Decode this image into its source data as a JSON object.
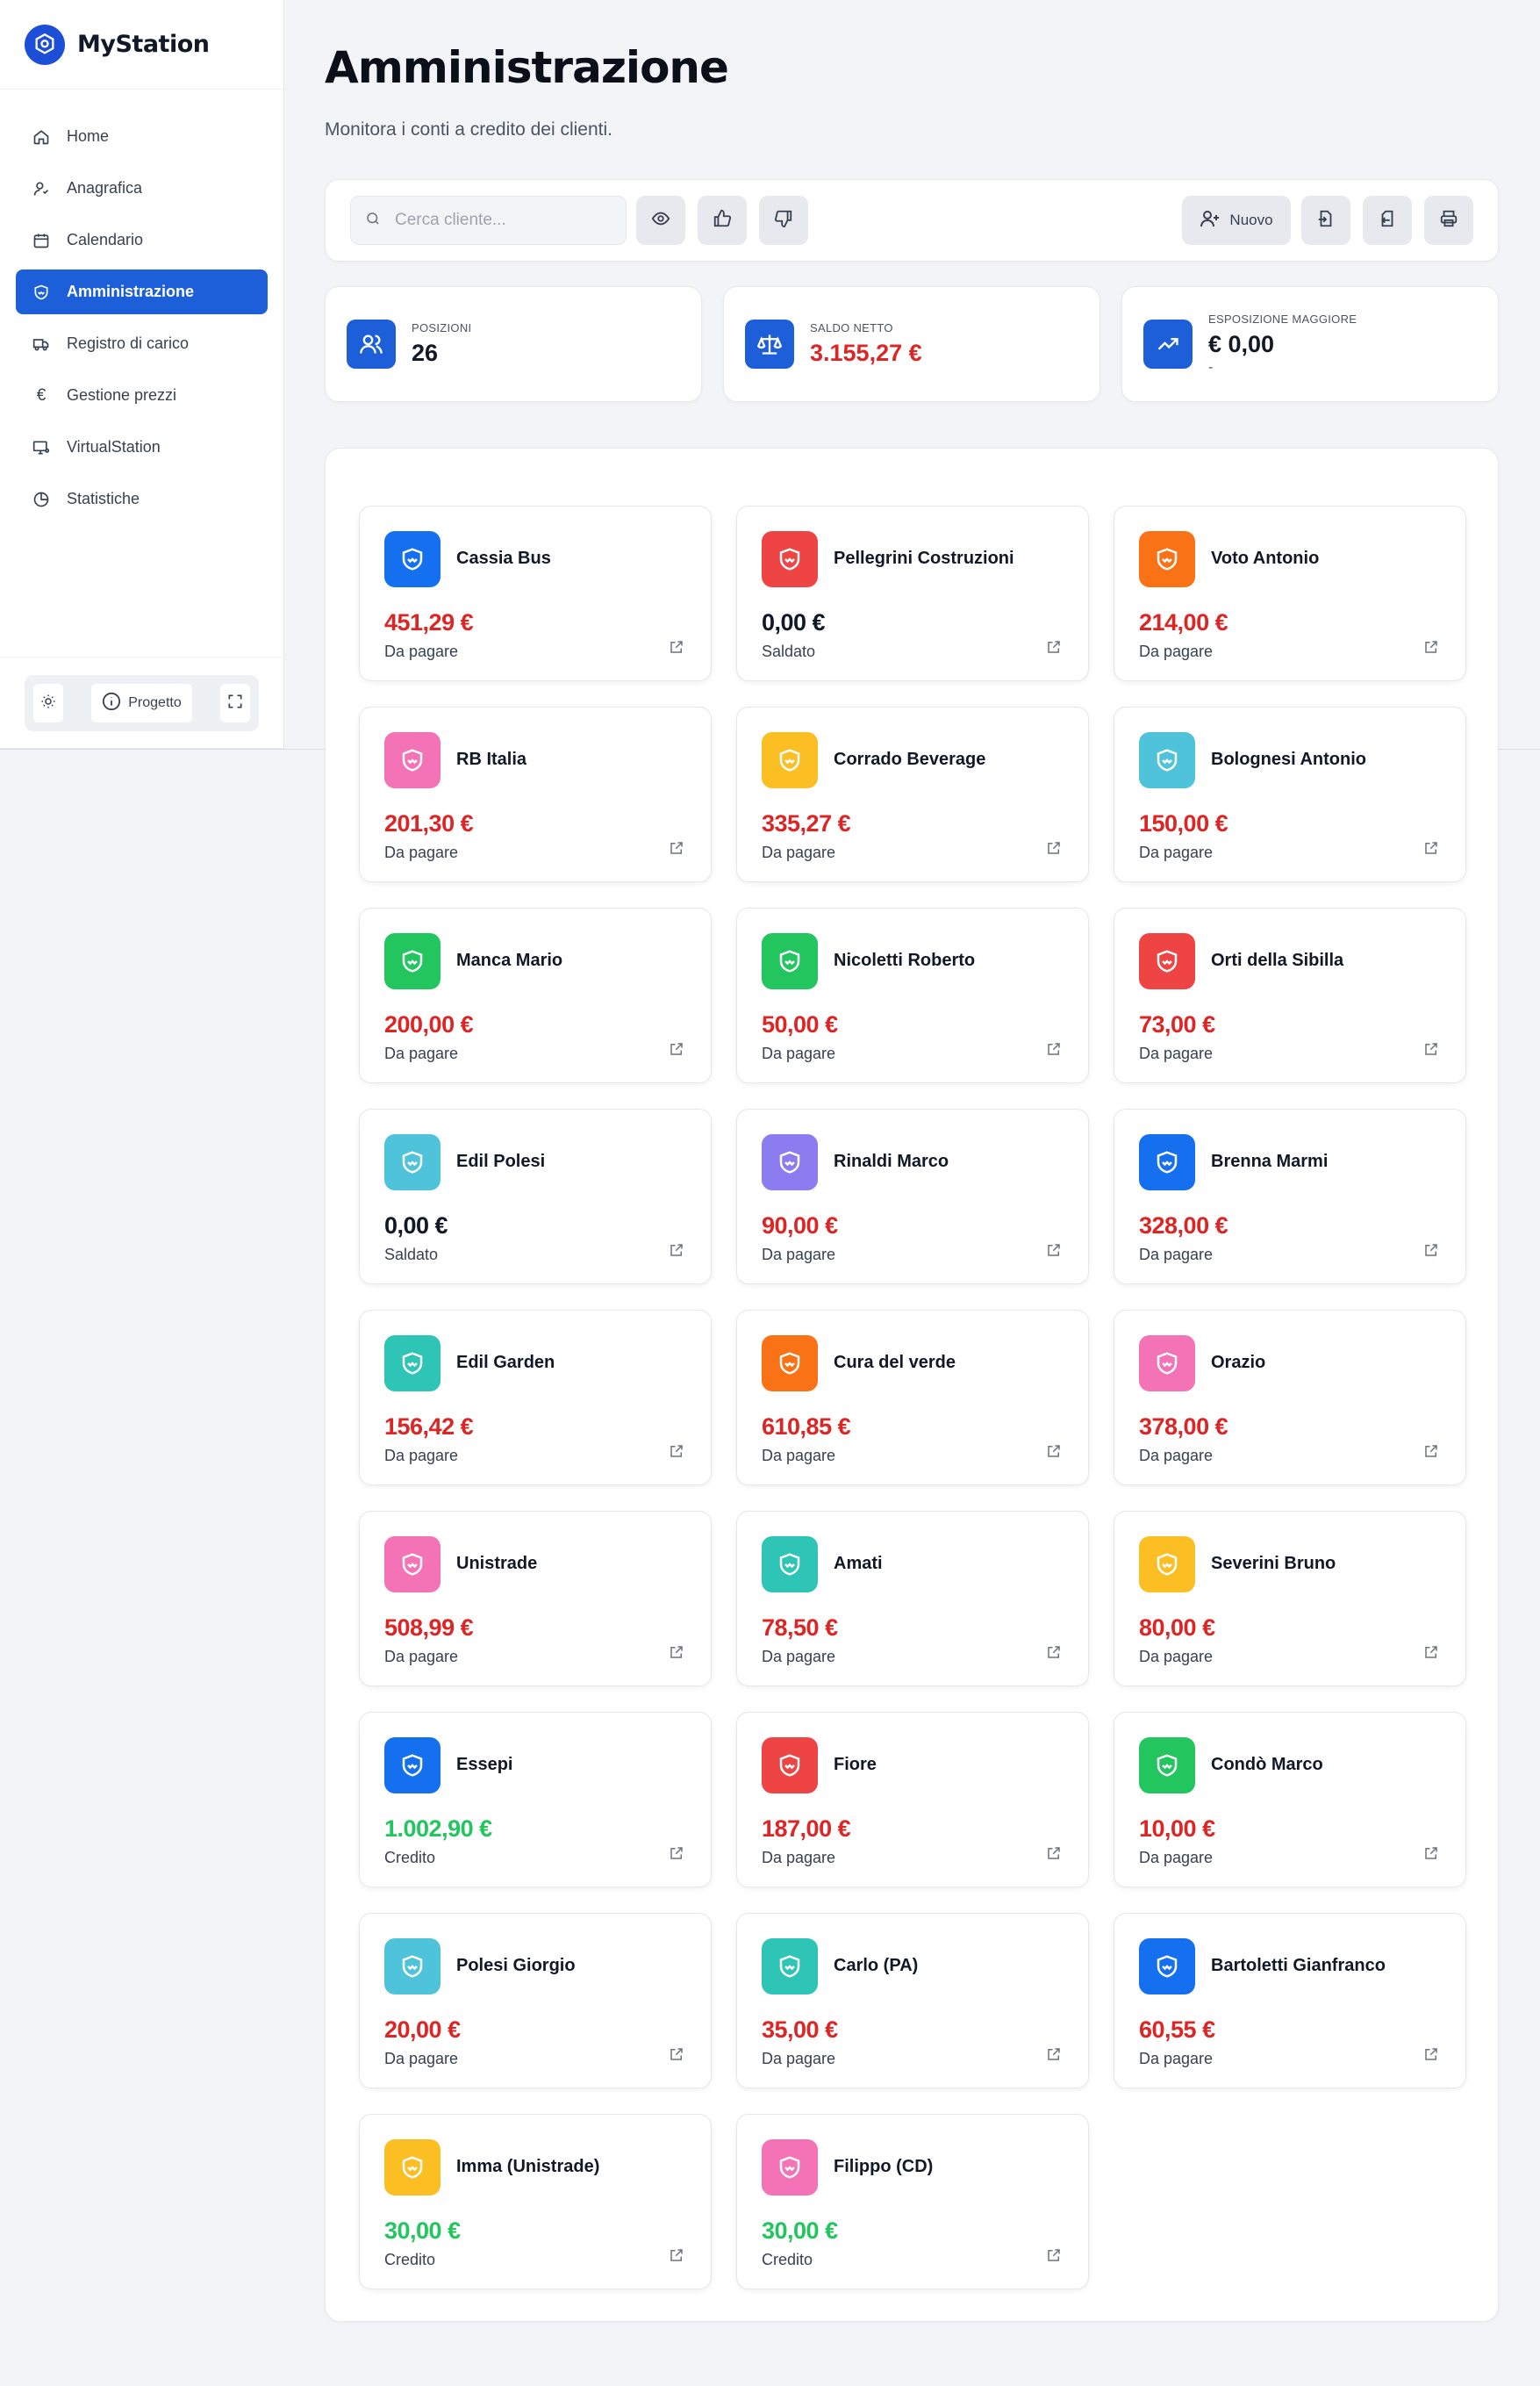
{
  "app": {
    "name": "MyStation"
  },
  "sidebar": {
    "items": [
      {
        "label": "Home",
        "icon": "home-icon",
        "active": false
      },
      {
        "label": "Anagrafica",
        "icon": "user-icon",
        "active": false
      },
      {
        "label": "Calendario",
        "icon": "calendar-icon",
        "active": false
      },
      {
        "label": "Amministrazione",
        "icon": "handshake-icon",
        "active": true
      },
      {
        "label": "Registro di carico",
        "icon": "truck-icon",
        "active": false
      },
      {
        "label": "Gestione prezzi",
        "icon": "euro-icon",
        "active": false
      },
      {
        "label": "VirtualStation",
        "icon": "monitor-icon",
        "active": false
      },
      {
        "label": "Statistiche",
        "icon": "pie-chart-icon",
        "active": false
      }
    ],
    "footer": {
      "project_label": "Progetto"
    }
  },
  "header": {
    "title": "Amministrazione",
    "subtitle": "Monitora i conti a credito dei clienti."
  },
  "toolbar": {
    "search_placeholder": "Cerca cliente...",
    "new_label": "Nuovo"
  },
  "stats": [
    {
      "label": "Posizioni",
      "value": "26",
      "sub": "",
      "color": "#111827",
      "icon": "users-icon"
    },
    {
      "label": "Saldo netto",
      "value": "3.155,27 €",
      "sub": "",
      "color": "#dc2626",
      "icon": "scale-icon"
    },
    {
      "label": "Esposizione maggiore",
      "value": "€ 0,00",
      "sub": "-",
      "color": "#111827",
      "icon": "trending-up-icon"
    }
  ],
  "colors": {
    "accent": "#1d5fd9",
    "due": "#dc2626",
    "credit": "#22c55e",
    "settled": "#111827"
  },
  "clients": [
    {
      "name": "Cassia Bus",
      "amount": "451,29 €",
      "status": "Da pagare",
      "color": "#1570ef",
      "kind": "due"
    },
    {
      "name": "Pellegrini Costruzioni",
      "amount": "0,00 €",
      "status": "Saldato",
      "color": "#ef4444",
      "kind": "settled"
    },
    {
      "name": "Voto Antonio",
      "amount": "214,00 €",
      "status": "Da pagare",
      "color": "#f97316",
      "kind": "due"
    },
    {
      "name": "RB Italia",
      "amount": "201,30 €",
      "status": "Da pagare",
      "color": "#f472b6",
      "kind": "due"
    },
    {
      "name": "Corrado Beverage",
      "amount": "335,27 €",
      "status": "Da pagare",
      "color": "#fbbf24",
      "kind": "due"
    },
    {
      "name": "Bolognesi Antonio",
      "amount": "150,00 €",
      "status": "Da pagare",
      "color": "#4fc3d9",
      "kind": "due"
    },
    {
      "name": "Manca Mario",
      "amount": "200,00 €",
      "status": "Da pagare",
      "color": "#22c55e",
      "kind": "due"
    },
    {
      "name": "Nicoletti Roberto",
      "amount": "50,00 €",
      "status": "Da pagare",
      "color": "#22c55e",
      "kind": "due"
    },
    {
      "name": "Orti della Sibilla",
      "amount": "73,00 €",
      "status": "Da pagare",
      "color": "#ef4444",
      "kind": "due"
    },
    {
      "name": "Edil Polesi",
      "amount": "0,00 €",
      "status": "Saldato",
      "color": "#4fc3d9",
      "kind": "settled"
    },
    {
      "name": "Rinaldi Marco",
      "amount": "90,00 €",
      "status": "Da pagare",
      "color": "#8b7cf0",
      "kind": "due"
    },
    {
      "name": "Brenna Marmi",
      "amount": "328,00 €",
      "status": "Da pagare",
      "color": "#1570ef",
      "kind": "due"
    },
    {
      "name": "Edil Garden",
      "amount": "156,42 €",
      "status": "Da pagare",
      "color": "#2ec4b6",
      "kind": "due"
    },
    {
      "name": "Cura del verde",
      "amount": "610,85 €",
      "status": "Da pagare",
      "color": "#f97316",
      "kind": "due"
    },
    {
      "name": "Orazio",
      "amount": "378,00 €",
      "status": "Da pagare",
      "color": "#f472b6",
      "kind": "due"
    },
    {
      "name": "Unistrade",
      "amount": "508,99 €",
      "status": "Da pagare",
      "color": "#f472b6",
      "kind": "due"
    },
    {
      "name": "Amati",
      "amount": "78,50 €",
      "status": "Da pagare",
      "color": "#2ec4b6",
      "kind": "due"
    },
    {
      "name": "Severini Bruno",
      "amount": "80,00 €",
      "status": "Da pagare",
      "color": "#fbbf24",
      "kind": "due"
    },
    {
      "name": "Essepi",
      "amount": "1.002,90 €",
      "status": "Credito",
      "color": "#1570ef",
      "kind": "credit"
    },
    {
      "name": "Fiore",
      "amount": "187,00 €",
      "status": "Da pagare",
      "color": "#ef4444",
      "kind": "due"
    },
    {
      "name": "Condò Marco",
      "amount": "10,00 €",
      "status": "Da pagare",
      "color": "#22c55e",
      "kind": "due"
    },
    {
      "name": "Polesi Giorgio",
      "amount": "20,00 €",
      "status": "Da pagare",
      "color": "#4fc3d9",
      "kind": "due"
    },
    {
      "name": "Carlo (PA)",
      "amount": "35,00 €",
      "status": "Da pagare",
      "color": "#2ec4b6",
      "kind": "due"
    },
    {
      "name": "Bartoletti Gianfranco",
      "amount": "60,55 €",
      "status": "Da pagare",
      "color": "#1570ef",
      "kind": "due"
    },
    {
      "name": "Imma (Unistrade)",
      "amount": "30,00 €",
      "status": "Credito",
      "color": "#fbbf24",
      "kind": "credit"
    },
    {
      "name": "Filippo (CD)",
      "amount": "30,00 €",
      "status": "Credito",
      "color": "#f472b6",
      "kind": "credit"
    }
  ]
}
